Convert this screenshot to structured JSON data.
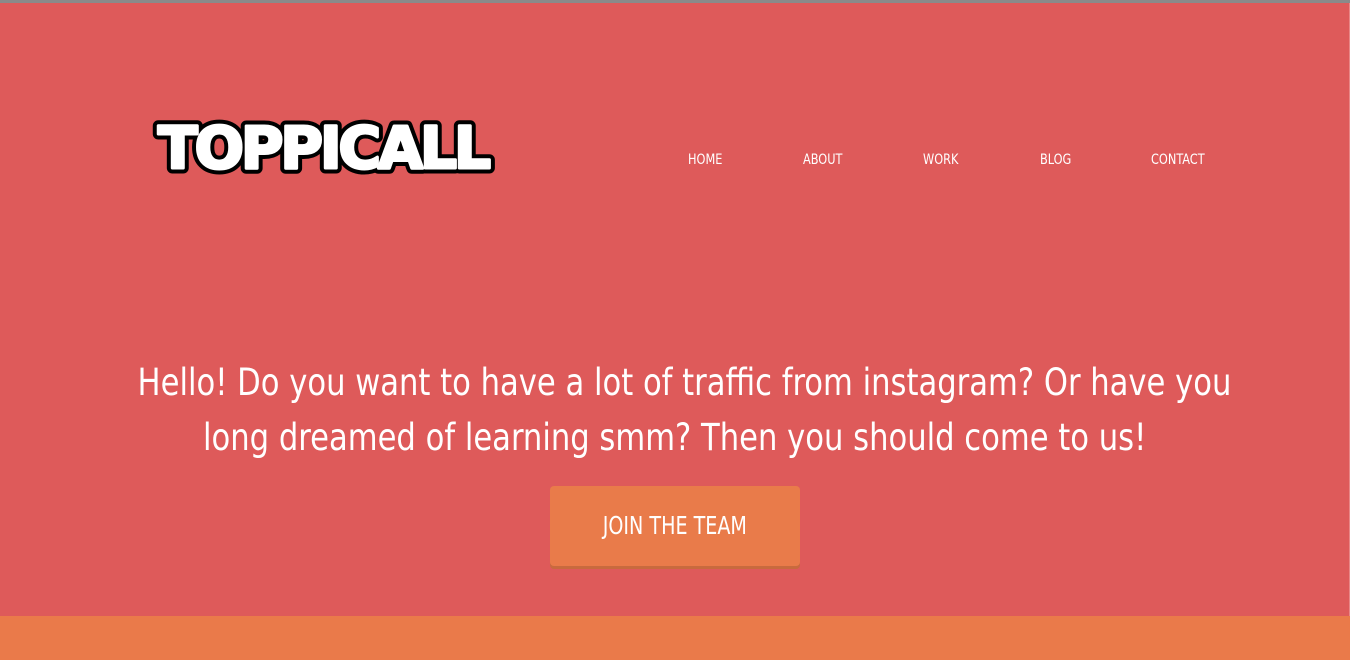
{
  "brand": {
    "logo_text": "TOPPICALL"
  },
  "nav": {
    "items": [
      {
        "label": "HOME"
      },
      {
        "label": "ABOUT"
      },
      {
        "label": "WORK"
      },
      {
        "label": "BLOG"
      },
      {
        "label": "CONTACT"
      }
    ]
  },
  "hero": {
    "headline_line1": "Hello! Do you want to have a lot of traffic from instagram? Or have you",
    "headline_line2": "long dreamed of learning smm? Then you should come to us!",
    "cta_label": "JOIN THE TEAM"
  },
  "colors": {
    "hero_background": "#de5a5a",
    "cta_background": "#e97b4a",
    "bottom_band": "#ea7a4a",
    "text": "#ffffff"
  }
}
